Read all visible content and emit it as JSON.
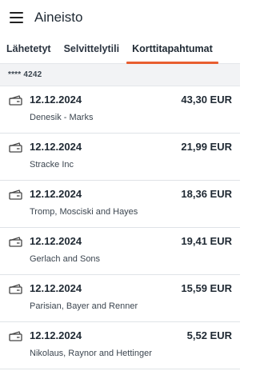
{
  "header": {
    "title": "Aineisto",
    "menu_icon": "hamburger-menu-icon"
  },
  "tabs": [
    {
      "label": "Lähetetyt",
      "active": false
    },
    {
      "label": "Selvittelytili",
      "active": false
    },
    {
      "label": "Korttitapahtumat",
      "active": true
    }
  ],
  "account": {
    "masked_number": "**** 4242"
  },
  "transactions": [
    {
      "date": "12.12.2024",
      "amount": "43,30 EUR",
      "merchant": "Denesik - Marks",
      "icon": "card-transaction-icon"
    },
    {
      "date": "12.12.2024",
      "amount": "21,99 EUR",
      "merchant": "Stracke Inc",
      "icon": "card-transaction-icon"
    },
    {
      "date": "12.12.2024",
      "amount": "18,36 EUR",
      "merchant": "Tromp, Mosciski and Hayes",
      "icon": "card-transaction-icon"
    },
    {
      "date": "12.12.2024",
      "amount": "19,41 EUR",
      "merchant": "Gerlach and Sons",
      "icon": "card-transaction-icon"
    },
    {
      "date": "12.12.2024",
      "amount": "15,59 EUR",
      "merchant": "Parisian, Bayer and Renner",
      "icon": "card-transaction-icon"
    },
    {
      "date": "12.12.2024",
      "amount": "5,52 EUR",
      "merchant": "Nikolaus, Raynor and Hettinger",
      "icon": "card-transaction-icon"
    }
  ],
  "colors": {
    "accent": "#e85d2f",
    "text": "#1f2933",
    "account_bar_bg": "#f2f3f5"
  }
}
